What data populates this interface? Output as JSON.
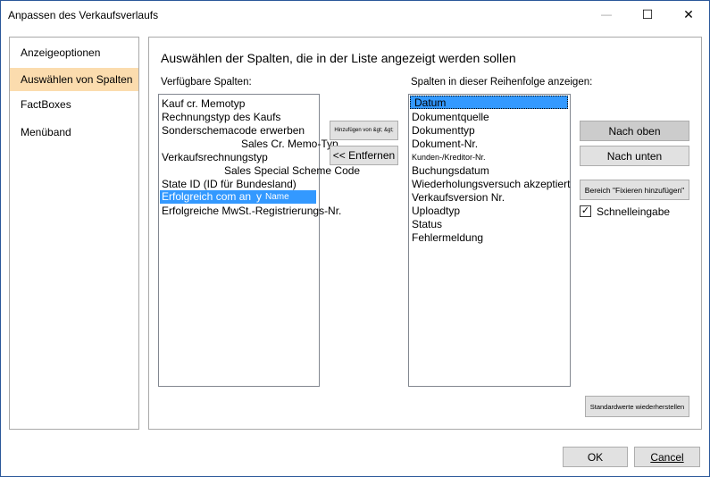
{
  "window": {
    "title": "Anpassen des Verkaufsverlaufs",
    "minimize_glyph": "—",
    "maximize_glyph": "☐",
    "close_glyph": "✕"
  },
  "nav": {
    "items": [
      {
        "label": "Anzeigeoptionen",
        "selected": false
      },
      {
        "label": "Auswählen von Spalten",
        "selected": true
      },
      {
        "label": "FactBoxes",
        "selected": false
      },
      {
        "label": "Menüband",
        "selected": false
      }
    ],
    "selected_color": "#fbdcae"
  },
  "main": {
    "heading": "Auswählen der Spalten, die in der Liste angezeigt werden sollen",
    "available_label": "Verfügbare Spalten:",
    "available_items": [
      "Kauf cr. Memotyp",
      "Rechnungstyp des Kaufs",
      "Sonderschemacode erwerben",
      "Sales Cr. Memo-Typ",
      "Verkaufsrechnungstyp",
      "Sales Special Scheme Code",
      "State ID (ID für Bundesland)",
      "Erfolgreich com an",
      "y",
      "Name",
      "Erfolgreiche MwSt.-Registrierungs-Nr."
    ],
    "add_button": "Hinzufügen von &gt; &gt;",
    "remove_button": "<< Entfernen",
    "shown_label": "Spalten in dieser Reihenfolge anzeigen:",
    "shown_items": [
      "Datum",
      "Dokumentquelle",
      "Dokumenttyp",
      "Dokument-Nr.",
      "Kunden-/Kreditor-Nr.",
      "Buchungsdatum",
      "Wiederholungsversuch akzeptiert",
      "Verkaufsversion Nr.",
      "Uploadtyp",
      "Status",
      "Fehlermeldung"
    ],
    "up_button": "Nach oben",
    "down_button": "Nach unten",
    "freeze_button": "Bereich \"Fixieren hinzufügen\"",
    "quick_entry_label": "Schnelleingabe",
    "quick_entry_checked": true,
    "check_glyph": "✓",
    "restore_button": "Standardwerte wiederherstellen"
  },
  "footer": {
    "ok_button": "OK",
    "cancel_button": "Cancel"
  },
  "colors": {
    "selection": "#3399ff",
    "border": "#2b579a"
  }
}
